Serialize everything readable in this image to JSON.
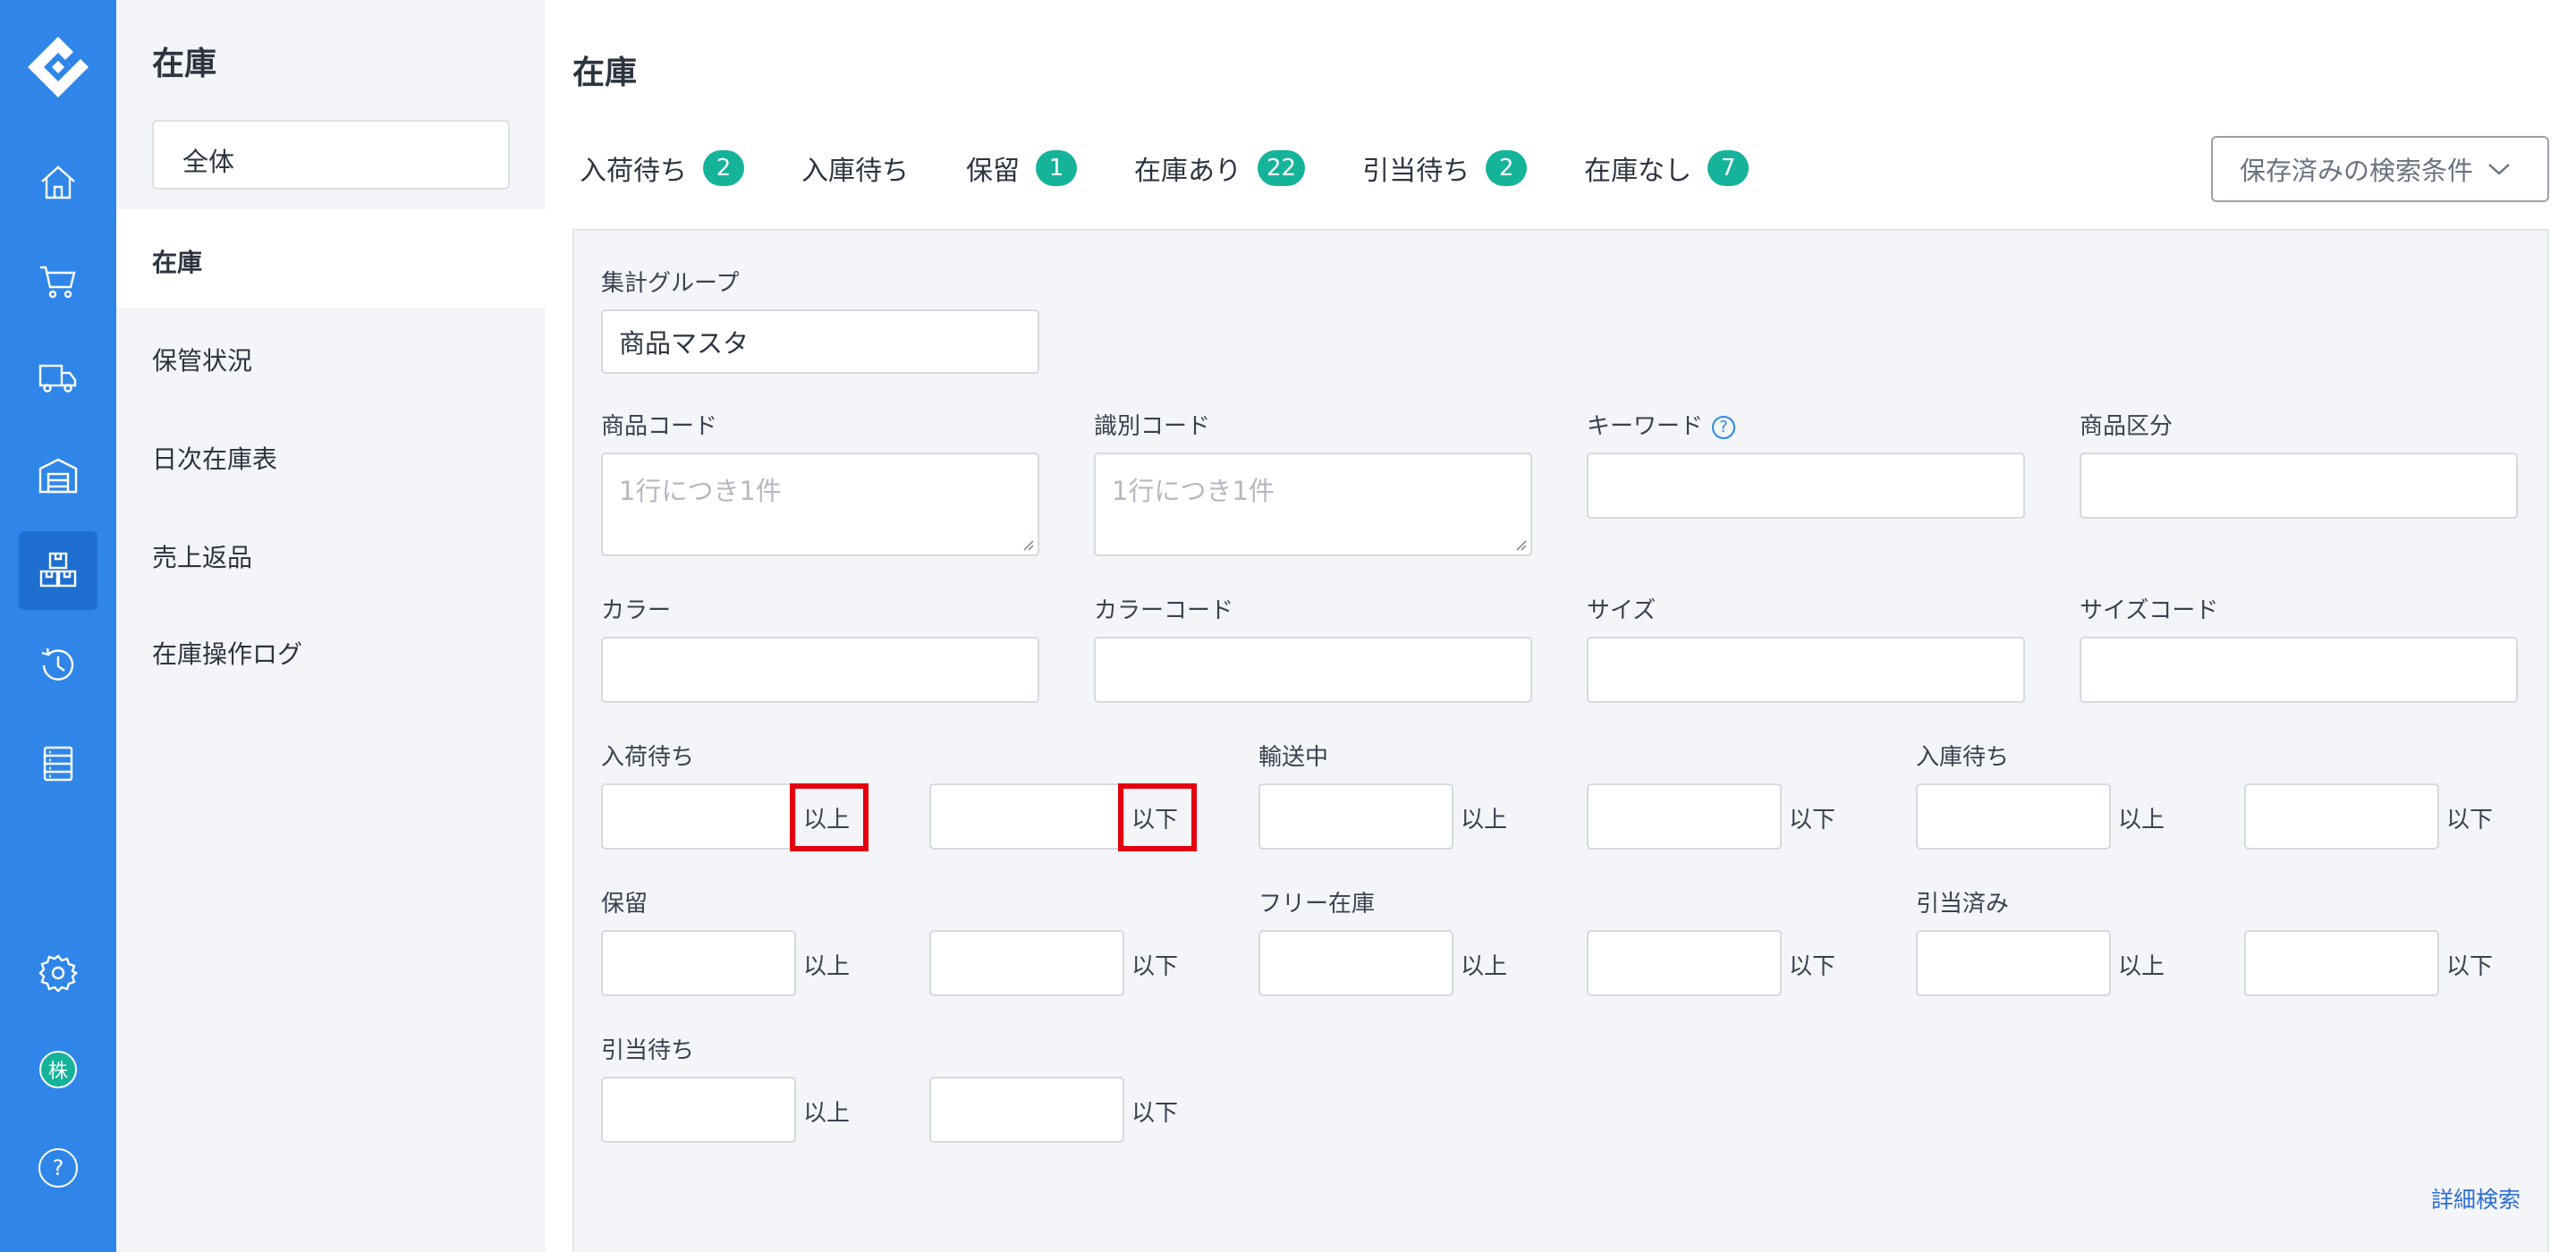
{
  "subnav": {
    "title": "在庫",
    "scope": "全体",
    "items": [
      {
        "label": "在庫",
        "active": true
      },
      {
        "label": "保管状況"
      },
      {
        "label": "日次在庫表"
      },
      {
        "label": "売上返品"
      },
      {
        "label": "在庫操作ログ"
      }
    ]
  },
  "main": {
    "title": "在庫",
    "tabs": [
      {
        "label": "入荷待ち",
        "count": "2"
      },
      {
        "label": "入庫待ち",
        "count": ""
      },
      {
        "label": "保留",
        "count": "1"
      },
      {
        "label": "在庫あり",
        "count": "22"
      },
      {
        "label": "引当待ち",
        "count": "2"
      },
      {
        "label": "在庫なし",
        "count": "7"
      }
    ],
    "saved_search": "保存済みの検索条件"
  },
  "form": {
    "group_label": "集計グループ",
    "group_value": "商品マスタ",
    "product_code_label": "商品コード",
    "product_code_placeholder": "1行につき1件",
    "id_code_label": "識別コード",
    "id_code_placeholder": "1行につき1件",
    "keyword_label": "キーワード",
    "category_label": "商品区分",
    "color_label": "カラー",
    "color_code_label": "カラーコード",
    "size_label": "サイズ",
    "size_code_label": "サイズコード",
    "ranges": [
      {
        "label": "入荷待ち",
        "min_unit": "以上",
        "max_unit": "以下"
      },
      {
        "label": "輸送中",
        "min_unit": "以上",
        "max_unit": "以下"
      },
      {
        "label": "入庫待ち",
        "min_unit": "以上",
        "max_unit": "以下"
      },
      {
        "label": "保留",
        "min_unit": "以上",
        "max_unit": "以下"
      },
      {
        "label": "フリー在庫",
        "min_unit": "以上",
        "max_unit": "以下"
      },
      {
        "label": "引当済み",
        "min_unit": "以上",
        "max_unit": "以下"
      },
      {
        "label": "引当待ち",
        "min_unit": "以上",
        "max_unit": "以下"
      }
    ],
    "help_glyph": "?",
    "advanced_search": "詳細検索"
  },
  "rail": {
    "icons": [
      "logo-icon",
      "home-icon",
      "cart-icon",
      "truck-icon",
      "warehouse-icon",
      "inventory-icon",
      "history-icon",
      "list-icon",
      "settings-icon",
      "company-icon",
      "help-icon"
    ],
    "company_glyph": "株",
    "help_glyph": "?",
    "colors": {
      "rail": "#2f86e8",
      "active": "#1e6fd0",
      "badge": "#15b39a",
      "highlight": "#e3000f"
    }
  }
}
